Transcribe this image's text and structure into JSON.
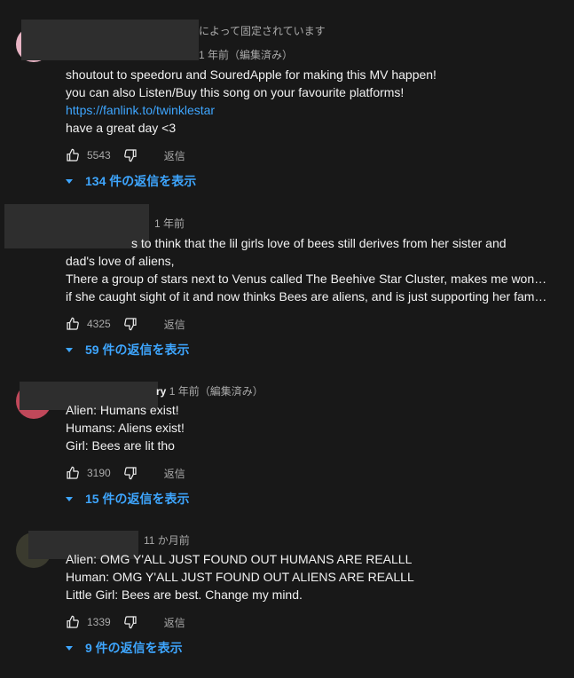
{
  "comments": [
    {
      "meta_prefix": "",
      "pinned_text": "によって固定されています",
      "meta": "1 年前（編集済み）",
      "lines": [
        "shoutout to speedoru and SouredApple for making this MV happen!",
        "you can also Listen/Buy this song on your favourite platforms!"
      ],
      "link": "https://fanlink.to/twinklestar",
      "lines_after": [
        "have a great day <3"
      ],
      "likes": "5543",
      "reply_label": "返信",
      "replies_label": "134 件の返信を表示",
      "avatar_color": "#e8b4c4"
    },
    {
      "meta": "1 年前",
      "lines": [
        "s to think that the lil girls love of bees still derives from her sister and",
        "dad's love of aliens,",
        "There a group of stars next to Venus called The Beehive Star Cluster, makes me wonder",
        "if she caught sight of it and now thinks Bees are aliens, and is just supporting her famil…"
      ],
      "likes": "4325",
      "reply_label": "返信",
      "replies_label": "59 件の返信を表示"
    },
    {
      "meta_prefix": "ry",
      "meta": "1 年前（編集済み）",
      "lines": [
        "Alien: Humans exist!",
        "Humans: Aliens exist!",
        "Girl: Bees are lit tho"
      ],
      "likes": "3190",
      "reply_label": "返信",
      "replies_label": "15 件の返信を表示",
      "avatar_color": "#c0485a"
    },
    {
      "meta": "11 か月前",
      "lines": [
        "Alien: OMG Y'ALL JUST FOUND OUT HUMANS ARE REALLL",
        "Human: OMG Y'ALL JUST FOUND OUT ALIENS ARE REALLL",
        "Little Girl: Bees are best. Change my mind."
      ],
      "likes": "1339",
      "reply_label": "返信",
      "replies_label": "9 件の返信を表示",
      "avatar_color": "#3a3a2e"
    }
  ]
}
